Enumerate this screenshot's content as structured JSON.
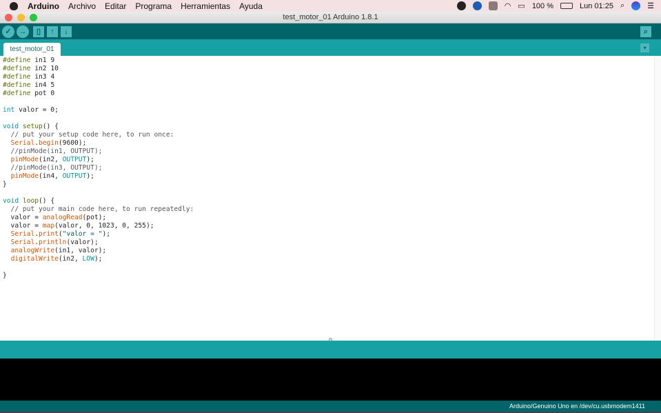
{
  "menubar": {
    "app": "Arduino",
    "items": [
      "Archivo",
      "Editar",
      "Programa",
      "Herramientas",
      "Ayuda"
    ],
    "battery": "100 %",
    "clock": "Lun 01:25"
  },
  "window": {
    "title": "test_motor_01 Arduino 1.8.1"
  },
  "toolbar": {
    "verify": "✓",
    "upload": "→",
    "new": "▯",
    "open": "↑",
    "save": "↓",
    "serial_monitor": "⌕"
  },
  "tabs": [
    {
      "label": "test_motor_01"
    }
  ],
  "tab_menu": "▾",
  "code": [
    [
      [
        "#define",
        "pre"
      ],
      [
        " in1 9",
        "plain"
      ]
    ],
    [
      [
        "#define",
        "pre"
      ],
      [
        " in2 10",
        "plain"
      ]
    ],
    [
      [
        "#define",
        "pre"
      ],
      [
        " in3 4",
        "plain"
      ]
    ],
    [
      [
        "#define",
        "pre"
      ],
      [
        " in4 5",
        "plain"
      ]
    ],
    [
      [
        "#define",
        "pre"
      ],
      [
        " pot 0",
        "plain"
      ]
    ],
    [],
    [
      [
        "int",
        "kw"
      ],
      [
        " valor = 0;",
        "plain"
      ]
    ],
    [],
    [
      [
        "void",
        "kw"
      ],
      [
        " ",
        "plain"
      ],
      [
        "setup",
        "pre"
      ],
      [
        "() {",
        "plain"
      ]
    ],
    [
      [
        "  // put your setup code here, to run once:",
        "cm"
      ]
    ],
    [
      [
        "  ",
        "plain"
      ],
      [
        "Serial",
        "fn"
      ],
      [
        ".",
        "plain"
      ],
      [
        "begin",
        "fn"
      ],
      [
        "(9600);",
        "plain"
      ]
    ],
    [
      [
        "  //pinMode(in1, OUTPUT);",
        "cm"
      ]
    ],
    [
      [
        "  ",
        "plain"
      ],
      [
        "pinMode",
        "fn"
      ],
      [
        "(in2, ",
        "plain"
      ],
      [
        "OUTPUT",
        "const"
      ],
      [
        ");",
        "plain"
      ]
    ],
    [
      [
        "  //pinMode(in3, OUTPUT);",
        "cm"
      ]
    ],
    [
      [
        "  ",
        "plain"
      ],
      [
        "pinMode",
        "fn"
      ],
      [
        "(in4, ",
        "plain"
      ],
      [
        "OUTPUT",
        "const"
      ],
      [
        ");",
        "plain"
      ]
    ],
    [
      [
        "}",
        "plain"
      ]
    ],
    [],
    [
      [
        "void",
        "kw"
      ],
      [
        " ",
        "plain"
      ],
      [
        "loop",
        "pre"
      ],
      [
        "() {",
        "plain"
      ]
    ],
    [
      [
        "  // put your main code here, to run repeatedly:",
        "cm"
      ]
    ],
    [
      [
        "  valor = ",
        "plain"
      ],
      [
        "analogRead",
        "fn"
      ],
      [
        "(pot);",
        "plain"
      ]
    ],
    [
      [
        "  valor = ",
        "plain"
      ],
      [
        "map",
        "fn"
      ],
      [
        "(valor, 0, 1023, 0, 255);",
        "plain"
      ]
    ],
    [
      [
        "  ",
        "plain"
      ],
      [
        "Serial",
        "fn"
      ],
      [
        ".",
        "plain"
      ],
      [
        "print",
        "fn"
      ],
      [
        "(",
        "plain"
      ],
      [
        "\"valor = \"",
        "str"
      ],
      [
        ");",
        "plain"
      ]
    ],
    [
      [
        "  ",
        "plain"
      ],
      [
        "Serial",
        "fn"
      ],
      [
        ".",
        "plain"
      ],
      [
        "println",
        "fn"
      ],
      [
        "(valor);",
        "plain"
      ]
    ],
    [
      [
        "  ",
        "plain"
      ],
      [
        "analogWrite",
        "fn"
      ],
      [
        "(in1, valor);",
        "plain"
      ]
    ],
    [
      [
        "  ",
        "plain"
      ],
      [
        "digitalWrite",
        "fn"
      ],
      [
        "(in2, ",
        "plain"
      ],
      [
        "LOW",
        "const"
      ],
      [
        ");",
        "plain"
      ]
    ],
    [],
    [
      [
        "}",
        "plain"
      ]
    ]
  ],
  "status": {
    "board": "Arduino/Genuino Uno en /dev/cu.usbmodem1411"
  },
  "colors": {
    "toolbar": "#006468",
    "tabbar": "#17a1a5",
    "console": "#000000"
  }
}
